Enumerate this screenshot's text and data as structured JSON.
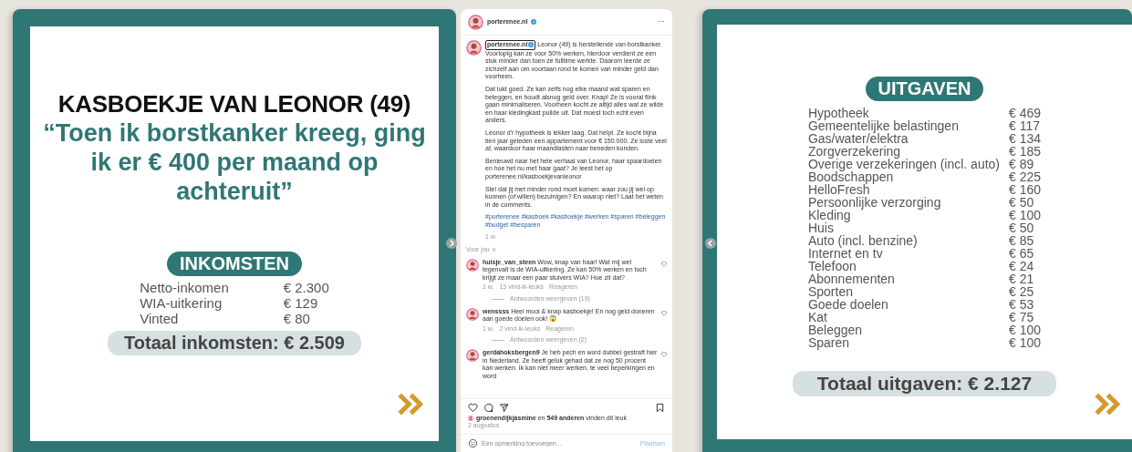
{
  "income_slide": {
    "title": "KASBOEKJE VAN LEONOR (49)",
    "quote": "“Toen ik borstkanker kreeg, ging ik er € 400 per maand op achteruit”",
    "section_label": "INKOMSTEN",
    "items": [
      {
        "label": "Netto-inkomen",
        "amount": "€ 2.300"
      },
      {
        "label": "WIA-uitkering",
        "amount": "€ 129"
      },
      {
        "label": "Vinted",
        "amount": "€ 80"
      }
    ],
    "total": "Totaal inkomsten: € 2.509"
  },
  "post": {
    "username": "porterenee.nl",
    "more": "···",
    "mention": "porterenee.nl",
    "caption": [
      "Leonor (49) is herstellende van borstkanker. Voorlopig kan ze voor 50% werken, hierdoor verdient ze een stuk minder dan toen ze fulltime werkte. Daarom leerde ze zichzelf aan om voortaan rond te komen van minder geld dan voorheen.",
      "Dat lukt goed. Ze kan zelfs nog elke maand wat sparen en beleggen, en houdt alsnog geld over. Knap! Ze is vooral flink gaan minimaliseren. Voorheen kocht ze altijd alles wat ze wilde en haar kledingkast puilde uit. Dat moest toch echt even anders.",
      "Leonor d'r hypotheek is lekker laag. Dat helpt. Ze kocht bijna tien jaar geleden een appartement voor € 150.000. Ze loste veel af, waardoor haar maandlasten naar beneden konden.",
      "Benieuwd naar het hele verhaal van Leonor, haar spaardoelen en hoe het nu met haar gaat? Je leest het op porterenee.nl/kasboekjevanleonor",
      "Stel dat jij met minder rond moet komen: waar zou jij wel op kunnen (of willen) bezuinigen? En waarop niet? Laat het weten in de comments."
    ],
    "hashtags": "#porterenee #kasboek #kasboekje #werken #sparen #beleggen #budget #besparen",
    "time": "1 w.",
    "for_you": "Voor jou ∨",
    "comments": [
      {
        "user": "huisje_van_steen",
        "text": "Wow, knap van haar! Wat mij wel tegenvalt is de WIA-uitkering. Ze kan 50% werken en toch krijgt ze maar een paar stuivers WIA? Hoe zit dat?",
        "time": "1 w.",
        "likes": "13 vind-ik-leuks",
        "reply": "Reageren",
        "replies": "Antwoorden weergeven (19)"
      },
      {
        "user": "wenssss",
        "text": "Heel mooi & knap kasboekje! En nog geld doneren aan goede doelen ook! 😱",
        "time": "1 w.",
        "likes": "2 vind-ik-leuks",
        "reply": "Reageren",
        "replies": "Antwoorden weergeven (2)"
      },
      {
        "user": "gerdahoksbergen9",
        "text": "Je heb pech en word dubbel gestraft hier in Nederland. Ze heeft geluk gehad dat ze nog 50 procent kan werken. Ik kan niet meer werken, te veel beperkingen en word"
      }
    ],
    "likes": "**groenendijkjasmine** en **549 anderen** vinden dit leuk",
    "date": "2 augustus",
    "comment_field": {
      "placeholder": "Een opmerking toevoegen..."
    },
    "post_button": "Plaatsen"
  },
  "expenses_slide": {
    "section_label": "UITGAVEN",
    "items": [
      {
        "label": "Hypotheek",
        "amount": "€ 469"
      },
      {
        "label": "Gemeentelijke belastingen",
        "amount": "€ 117"
      },
      {
        "label": "Gas/water/elektra",
        "amount": "€ 134"
      },
      {
        "label": "Zorgverzekering",
        "amount": "€ 185"
      },
      {
        "label": "Overige verzekeringen (incl. auto)",
        "amount": "€ 89"
      },
      {
        "label": "Boodschappen",
        "amount": "€ 225"
      },
      {
        "label": "HelloFresh",
        "amount": "€ 160"
      },
      {
        "label": "Persoonlijke verzorging",
        "amount": "€ 50"
      },
      {
        "label": "Kleding",
        "amount": "€ 100"
      },
      {
        "label": "Huis",
        "amount": "€ 50"
      },
      {
        "label": "Auto (incl. benzine)",
        "amount": "€ 85"
      },
      {
        "label": "Internet en tv",
        "amount": "€ 65"
      },
      {
        "label": "Telefoon",
        "amount": "€ 24"
      },
      {
        "label": "Abonnementen",
        "amount": "€ 21"
      },
      {
        "label": "Sporten",
        "amount": "€ 25"
      },
      {
        "label": "Goede doelen",
        "amount": "€ 53"
      },
      {
        "label": "Kat",
        "amount": "€ 75"
      },
      {
        "label": "Beleggen",
        "amount": "€ 100"
      },
      {
        "label": "Sparen",
        "amount": "€ 100"
      }
    ],
    "total": "Totaal uitgaven: € 2.127"
  }
}
